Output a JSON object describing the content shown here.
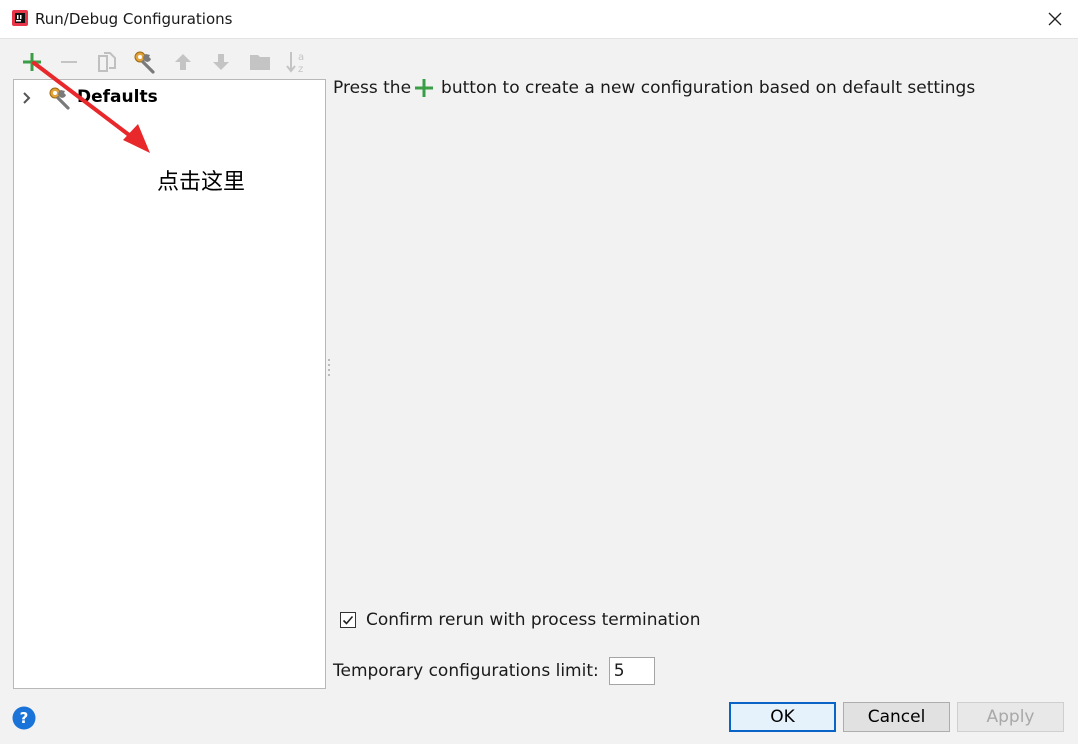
{
  "window": {
    "title": "Run/Debug Configurations",
    "app_icon": "intellij-idea-icon",
    "close_icon": "close-icon"
  },
  "toolbar": {
    "buttons": [
      {
        "name": "add",
        "icon": "plus-icon",
        "enabled": true,
        "color": "#3a9e47"
      },
      {
        "name": "remove",
        "icon": "minus-icon",
        "enabled": false
      },
      {
        "name": "copy",
        "icon": "copy-icon",
        "enabled": false
      },
      {
        "name": "edit-defaults",
        "icon": "wrench-icon",
        "enabled": true
      },
      {
        "name": "move-up",
        "icon": "arrow-up-icon",
        "enabled": false
      },
      {
        "name": "move-down",
        "icon": "arrow-down-icon",
        "enabled": false
      },
      {
        "name": "folder",
        "icon": "folder-icon",
        "enabled": false
      },
      {
        "name": "sort",
        "icon": "sort-az-icon",
        "enabled": false
      }
    ]
  },
  "tree": {
    "items": [
      {
        "label": "Defaults",
        "expanded": false,
        "icon": "wrench-icon"
      }
    ]
  },
  "annotation": {
    "text": "点击这里",
    "arrow_color": "#e8282b"
  },
  "main": {
    "hint_before": "Press the",
    "hint_after": "button to create a new configuration based on default settings",
    "confirm_label": "Confirm rerun with process termination",
    "confirm_checked": true,
    "limit_label": "Temporary configurations limit:",
    "limit_value": "5"
  },
  "footer": {
    "help_icon": "help-icon",
    "ok_label": "OK",
    "cancel_label": "Cancel",
    "apply_label": "Apply",
    "apply_enabled": false
  },
  "colors": {
    "accent_green": "#3a9e47",
    "focus_blue": "#0a64c8",
    "help_blue": "#1a73d9"
  }
}
